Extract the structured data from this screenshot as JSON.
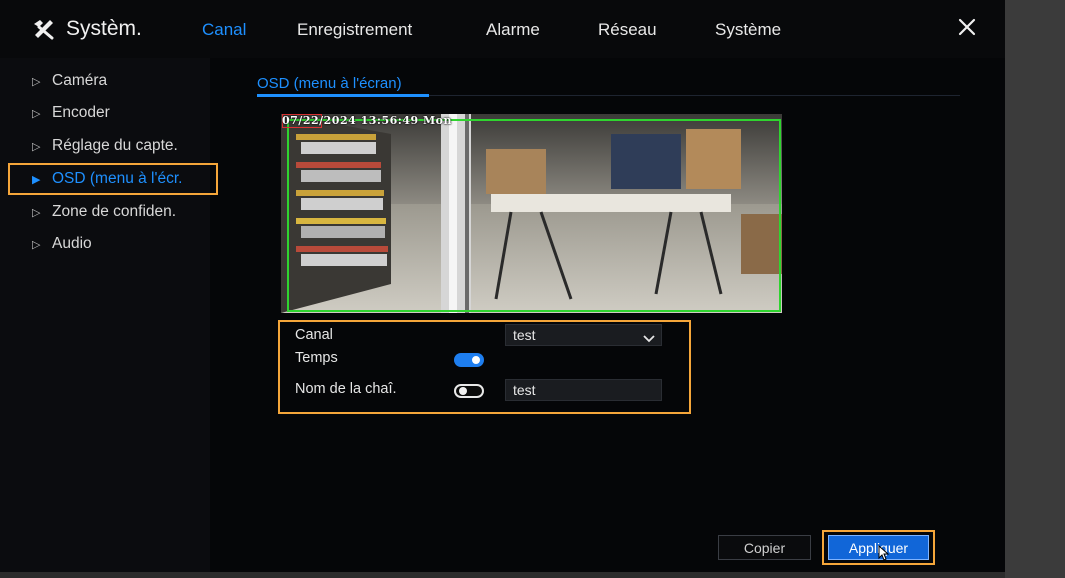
{
  "brand": {
    "icon": "tools-icon",
    "title": "Systèm."
  },
  "nav": {
    "tabs": [
      {
        "label": "Canal",
        "active": true
      },
      {
        "label": "Enregistrement",
        "active": false
      },
      {
        "label": "Alarme",
        "active": false
      },
      {
        "label": "Réseau",
        "active": false
      },
      {
        "label": "Système",
        "active": false
      }
    ],
    "close_icon": "close-icon"
  },
  "sidebar": {
    "items": [
      {
        "label": "Caméra",
        "active": false
      },
      {
        "label": "Encoder",
        "active": false
      },
      {
        "label": "Réglage du capte.",
        "active": false
      },
      {
        "label": "OSD (menu à l'écr.",
        "active": true
      },
      {
        "label": "Zone de confiden.",
        "active": false
      },
      {
        "label": "Audio",
        "active": false
      }
    ]
  },
  "content": {
    "tab_label": "OSD (menu à l'écran)",
    "preview": {
      "osd_timestamp": "07/22/2024 13:56:49 Mon"
    },
    "form": {
      "canal_label": "Canal",
      "canal_value": "test",
      "temps_label": "Temps",
      "temps_on": true,
      "nom_label": "Nom de la chaî.",
      "nom_on": false,
      "nom_value": "test"
    },
    "buttons": {
      "copy": "Copier",
      "apply": "Appliquer"
    }
  },
  "colors": {
    "accent": "#1e90ff",
    "highlight": "#f5a63a",
    "osd_border": "#2fd42f"
  }
}
